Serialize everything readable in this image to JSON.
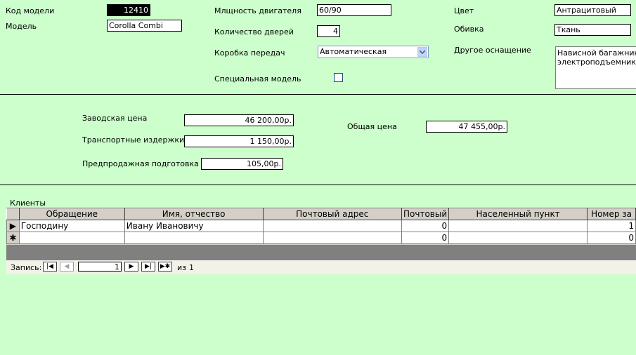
{
  "form": {
    "model_code_label": "Код модели",
    "model_code_value": "12410",
    "model_label": "Модель",
    "model_value": "Corolla Combi",
    "engine_power_label": "Млщность двигателя",
    "engine_power_value": "60/90",
    "doors_label": "Количество дверей",
    "doors_value": "4",
    "gearbox_label": "Коробка передач",
    "gearbox_value": "Автоматическая",
    "special_label": "Специальная модель",
    "special_checked": false,
    "color_label": "Цвет",
    "color_value": "Антрацитовый",
    "upholstery_label": "Обивка",
    "upholstery_value": "Ткань",
    "other_equipment_label": "Другое оснащение",
    "other_equipment_line1": "Нависной багажник, р",
    "other_equipment_line2": "электроподъемник ок"
  },
  "pricing": {
    "factory_price_label": "Заводская цена",
    "factory_price_value": "46 200,00р.",
    "transport_label": "Транспортные издержки",
    "transport_value": "1 150,00р.",
    "presale_label": "Предпродажная подготовка",
    "presale_value": "105,00р.",
    "total_label": "Общая цена",
    "total_value": "47 455,00р."
  },
  "clients": {
    "caption": "Клиенты",
    "columns": [
      "Обращение",
      "Имя, отчество",
      "Почтовый адрес",
      "Почтовый",
      "Населенный пункт",
      "Номер за"
    ],
    "rows": [
      {
        "marker": "▶",
        "cells": [
          "Господину",
          "Ивану Ивановичу",
          "",
          "0",
          "",
          "1"
        ]
      },
      {
        "marker": "✱",
        "cells": [
          "",
          "",
          "",
          "0",
          "",
          "0"
        ]
      }
    ],
    "nav": {
      "record_label": "Запись:",
      "current": "1",
      "of_label": "из",
      "total": "1"
    }
  },
  "colors": {
    "background": "#ccffcc",
    "grid_header": "#d4d0c8"
  }
}
